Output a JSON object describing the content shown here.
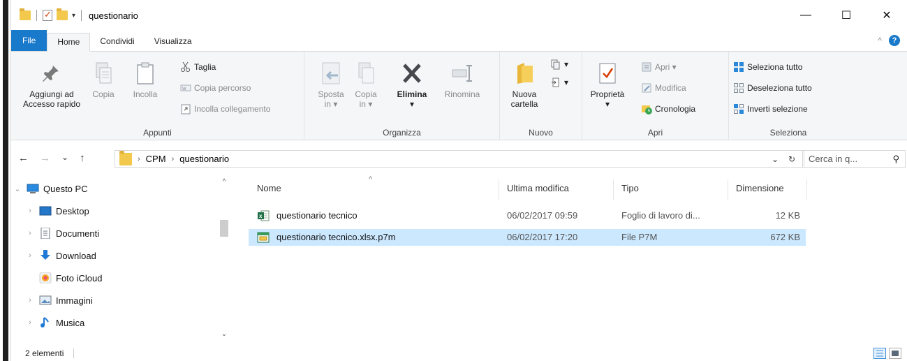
{
  "window": {
    "title": "questionario",
    "controls": {
      "minimize": "—",
      "maximize": "☐",
      "close": "✕"
    }
  },
  "quick_access": {
    "dropdown_arrow": "▾"
  },
  "tabs": [
    {
      "label": "File",
      "active": false
    },
    {
      "label": "Home",
      "active": true
    },
    {
      "label": "Condividi",
      "active": false
    },
    {
      "label": "Visualizza",
      "active": false
    }
  ],
  "ribbon": {
    "appunti": {
      "label": "Appunti",
      "pin": "Aggiungi ad Accesso rapido",
      "pin_l1": "Aggiungi ad",
      "pin_l2": "Accesso rapido",
      "copia": "Copia",
      "incolla": "Incolla",
      "taglia": "Taglia",
      "copia_percorso": "Copia percorso",
      "incolla_collegamento": "Incolla collegamento"
    },
    "organizza": {
      "label": "Organizza",
      "sposta_l1": "Sposta",
      "sposta_l2": "in ▾",
      "copia_l1": "Copia",
      "copia_l2": "in ▾",
      "elimina": "Elimina",
      "elimina_arrow": "▾",
      "rinomina": "Rinomina"
    },
    "nuovo": {
      "label": "Nuovo",
      "nuova_l1": "Nuova",
      "nuova_l2": "cartella"
    },
    "apri": {
      "label": "Apri",
      "proprieta": "Proprietà",
      "proprieta_arrow": "▾",
      "apri": "Apri ▾",
      "modifica": "Modifica",
      "cronologia": "Cronologia"
    },
    "seleziona": {
      "label": "Seleziona",
      "tutto": "Seleziona tutto",
      "deseleziona": "Deseleziona tutto",
      "inverti": "Inverti selezione"
    }
  },
  "address": {
    "back": "←",
    "forward": "→",
    "recent": "⌄",
    "up": "↑",
    "crumbs": [
      "CPM",
      "questionario"
    ],
    "separator": "›",
    "dropdown": "⌄",
    "refresh": "↻",
    "search_placeholder": "Cerca in q...",
    "search_icon": "⚲"
  },
  "nav_tree": [
    {
      "label": "Questo PC",
      "expander": "⌄",
      "icon": "pc-icon"
    },
    {
      "label": "Desktop",
      "expander": "›",
      "icon": "desktop-icon"
    },
    {
      "label": "Documenti",
      "expander": "›",
      "icon": "documents-icon"
    },
    {
      "label": "Download",
      "expander": "›",
      "icon": "download-icon"
    },
    {
      "label": "Foto iCloud",
      "expander": "",
      "icon": "icloud-photos-icon"
    },
    {
      "label": "Immagini",
      "expander": "›",
      "icon": "pictures-icon"
    },
    {
      "label": "Musica",
      "expander": "›",
      "icon": "music-icon"
    }
  ],
  "columns": {
    "name": "Nome",
    "modified": "Ultima modifica",
    "type": "Tipo",
    "size": "Dimensione",
    "sort_caret": "^"
  },
  "files": [
    {
      "name": "questionario tecnico",
      "modified": "06/02/2017 09:59",
      "type": "Foglio di lavoro di...",
      "size": "12 KB",
      "selected": false,
      "icon": "excel-file-icon"
    },
    {
      "name": "questionario tecnico.xlsx.p7m",
      "modified": "06/02/2017 17:20",
      "type": "File P7M",
      "size": "672 KB",
      "selected": true,
      "icon": "p7m-file-icon"
    }
  ],
  "status": {
    "count": "2 elementi"
  },
  "colors": {
    "accent": "#1979ca",
    "selection": "#cce8ff",
    "folder": "#f2c94c"
  }
}
